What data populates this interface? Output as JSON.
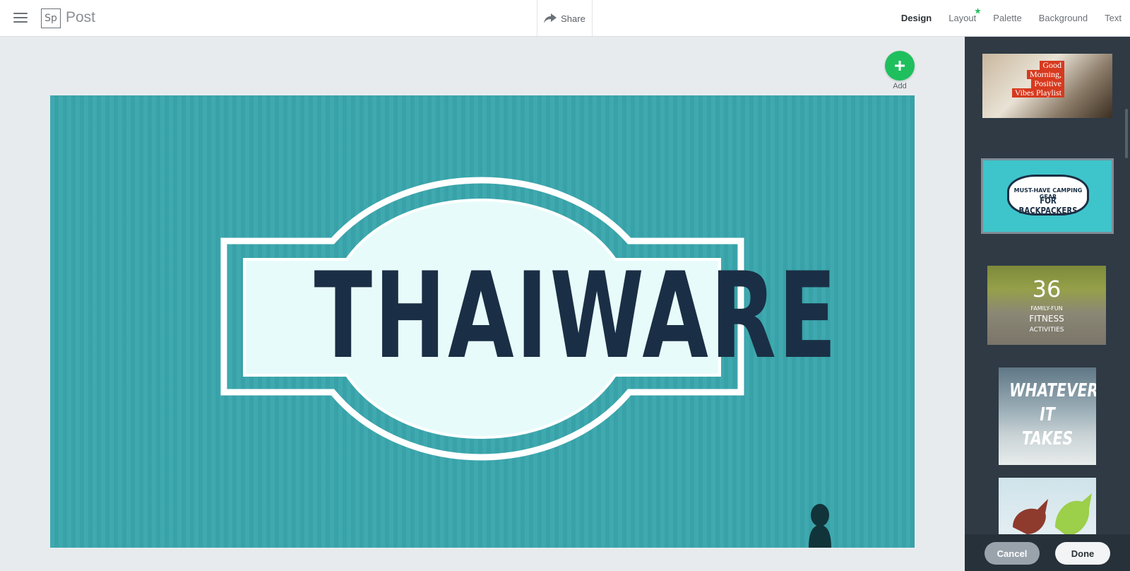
{
  "header": {
    "app_logo": "Sp",
    "app_name": "Post",
    "share_label": "Share",
    "tabs": [
      {
        "label": "Design",
        "active": true
      },
      {
        "label": "Layout",
        "active": false,
        "starred": true
      },
      {
        "label": "Palette",
        "active": false
      },
      {
        "label": "Background",
        "active": false
      },
      {
        "label": "Text",
        "active": false
      }
    ]
  },
  "add_button": {
    "label": "Add"
  },
  "canvas": {
    "title": "THAIWARE",
    "background_color": "#3aa7ad",
    "text_color": "#1a2f45"
  },
  "design_panel": {
    "thumbnails": [
      {
        "lines": [
          "Good",
          "Morning,",
          "Positive",
          "Vibes Playlist"
        ]
      },
      {
        "lines": [
          "MUST-HAVE CAMPING GEAR",
          "FOR BACKPACKERS"
        ],
        "selected": true
      },
      {
        "lines": [
          "36",
          "FAMILY-FUN",
          "FITNESS",
          "ACTIVITIES"
        ]
      },
      {
        "lines": [
          "WHATEVER",
          "IT",
          "TAKES"
        ]
      },
      {
        "lines": []
      }
    ],
    "cancel_label": "Cancel",
    "done_label": "Done"
  },
  "colors": {
    "accent_green": "#1fbf5e",
    "panel_bg": "#2f3a45"
  }
}
